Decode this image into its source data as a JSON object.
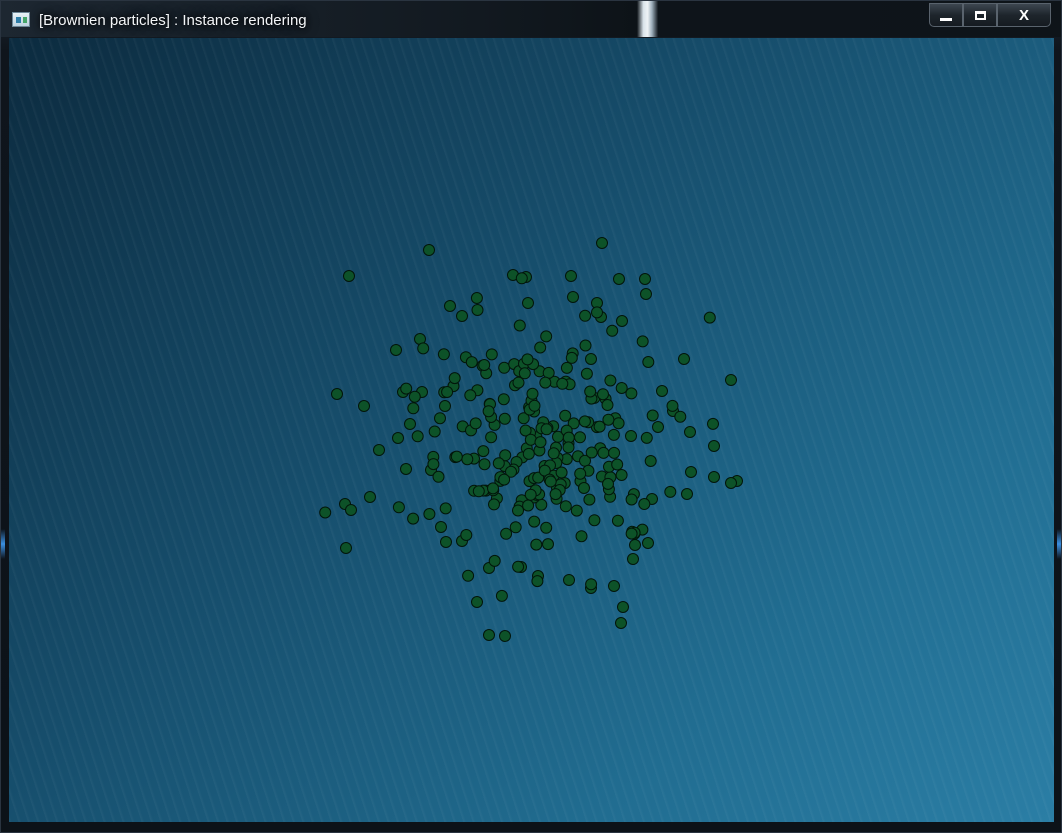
{
  "window": {
    "title": "[Brownien particles] : Instance rendering",
    "controls": {
      "minimize": "minimize",
      "maximize": "maximize",
      "close": "X"
    }
  },
  "scene": {
    "particle_color": "#0d5228",
    "particle_outline": "#02150a",
    "background_colors": [
      "#0c2b3f",
      "#2b7ea5"
    ]
  }
}
